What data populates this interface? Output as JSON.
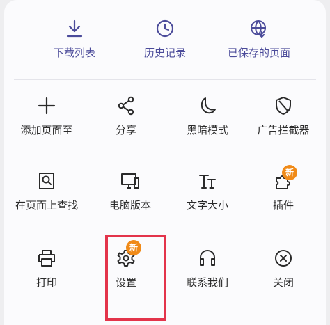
{
  "top_row": [
    {
      "label": "下载列表",
      "icon": "download-icon"
    },
    {
      "label": "历史记录",
      "icon": "clock-icon"
    },
    {
      "label": "已保存的页面",
      "icon": "saved-page-globe-icon"
    }
  ],
  "grid": [
    {
      "label": "添加页面至",
      "icon": "plus-icon"
    },
    {
      "label": "分享",
      "icon": "share-icon"
    },
    {
      "label": "黑暗模式",
      "icon": "moon-icon"
    },
    {
      "label": "广告拦截器",
      "icon": "shield-icon"
    },
    {
      "label": "在页面上查找",
      "icon": "find-in-page-icon"
    },
    {
      "label": "电脑版本",
      "icon": "desktop-icon"
    },
    {
      "label": "文字大小",
      "icon": "text-size-icon"
    },
    {
      "label": "插件",
      "icon": "puzzle-icon",
      "badge": "新"
    },
    {
      "label": "打印",
      "icon": "printer-icon"
    },
    {
      "label": "设置",
      "icon": "gear-icon",
      "badge": "新"
    },
    {
      "label": "联系我们",
      "icon": "headset-icon"
    },
    {
      "label": "关闭",
      "icon": "close-circle-icon"
    }
  ],
  "colors": {
    "accent_top": "#4b4b9a",
    "badge": "#f08a18",
    "highlight": "#e3344b"
  }
}
